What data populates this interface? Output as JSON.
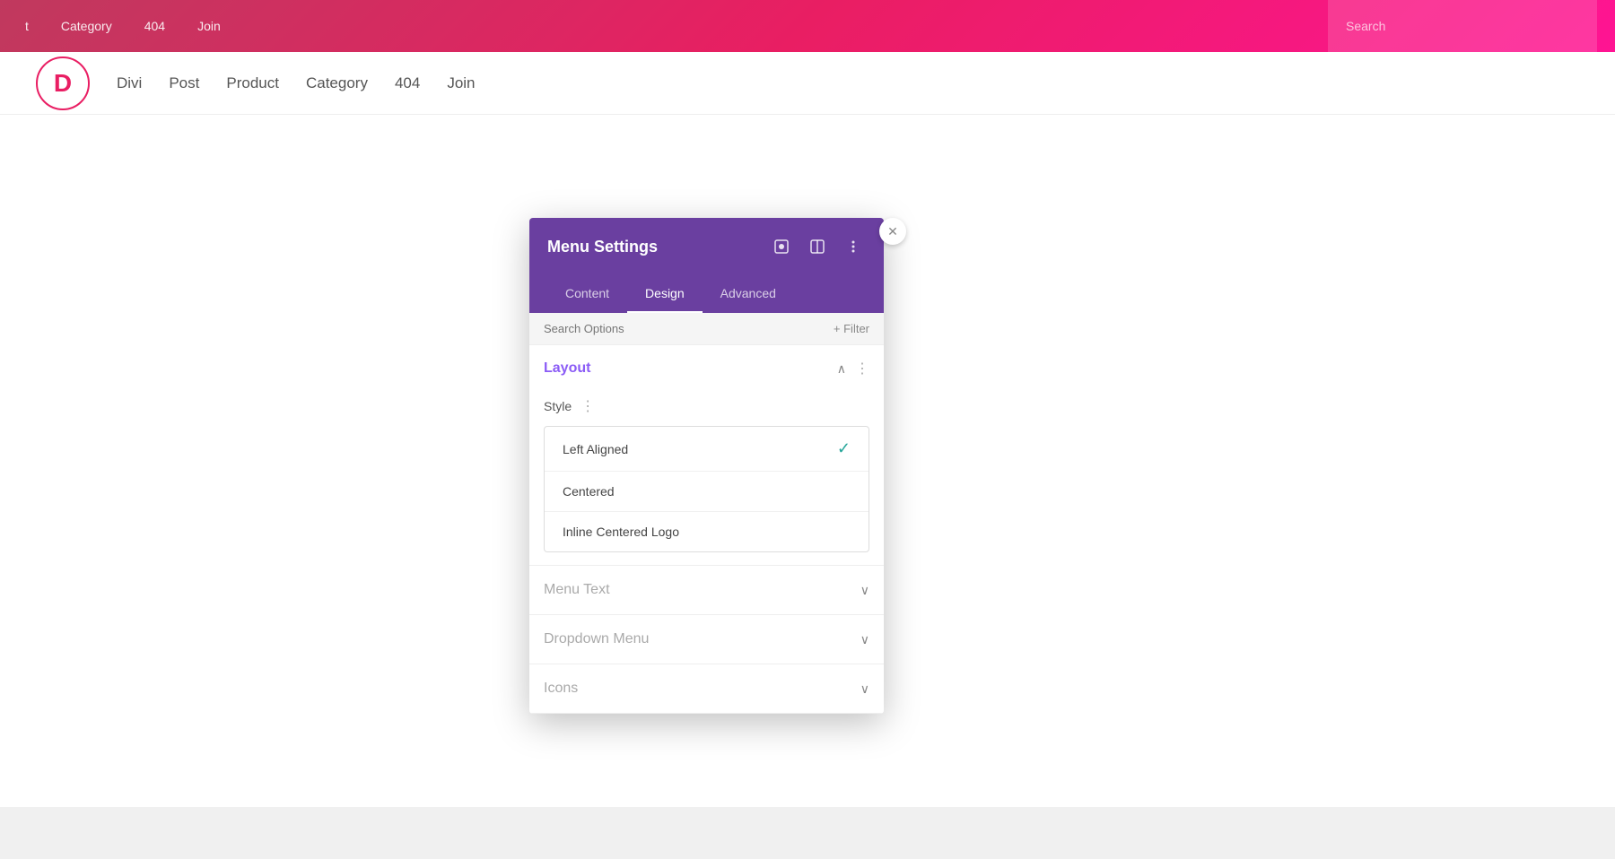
{
  "adminBar": {
    "items": [
      {
        "label": "t"
      },
      {
        "label": "Category"
      },
      {
        "label": "404"
      },
      {
        "label": "Join"
      }
    ],
    "searchPlaceholder": "Search"
  },
  "siteNav": {
    "logoLetter": "D",
    "items": [
      {
        "label": "Divi"
      },
      {
        "label": "Post"
      },
      {
        "label": "Product"
      },
      {
        "label": "Category"
      },
      {
        "label": "404"
      },
      {
        "label": "Join"
      }
    ]
  },
  "panel": {
    "title": "Menu Settings",
    "tabs": [
      {
        "label": "Content"
      },
      {
        "label": "Design"
      },
      {
        "label": "Advanced"
      }
    ],
    "activeTab": "Design",
    "searchPlaceholder": "Search Options",
    "filterLabel": "+ Filter",
    "sections": [
      {
        "id": "layout",
        "title": "Layout",
        "expanded": true,
        "styleLabel": "Style",
        "dropdownOptions": [
          {
            "label": "Left Aligned",
            "selected": true
          },
          {
            "label": "Centered",
            "selected": false
          },
          {
            "label": "Inline Centered Logo",
            "selected": false
          }
        ]
      },
      {
        "id": "menuText",
        "title": "Menu Text",
        "expanded": false
      },
      {
        "id": "dropdownMenu",
        "title": "Dropdown Menu",
        "expanded": false
      },
      {
        "id": "icons",
        "title": "Icons",
        "expanded": false
      }
    ]
  },
  "icons": {
    "checkmark": "✓",
    "chevronDown": "∨",
    "chevronUp": "∧",
    "dots": "⋮",
    "close": "✕",
    "expand": "⊡",
    "split": "⊞",
    "filter": "+"
  }
}
